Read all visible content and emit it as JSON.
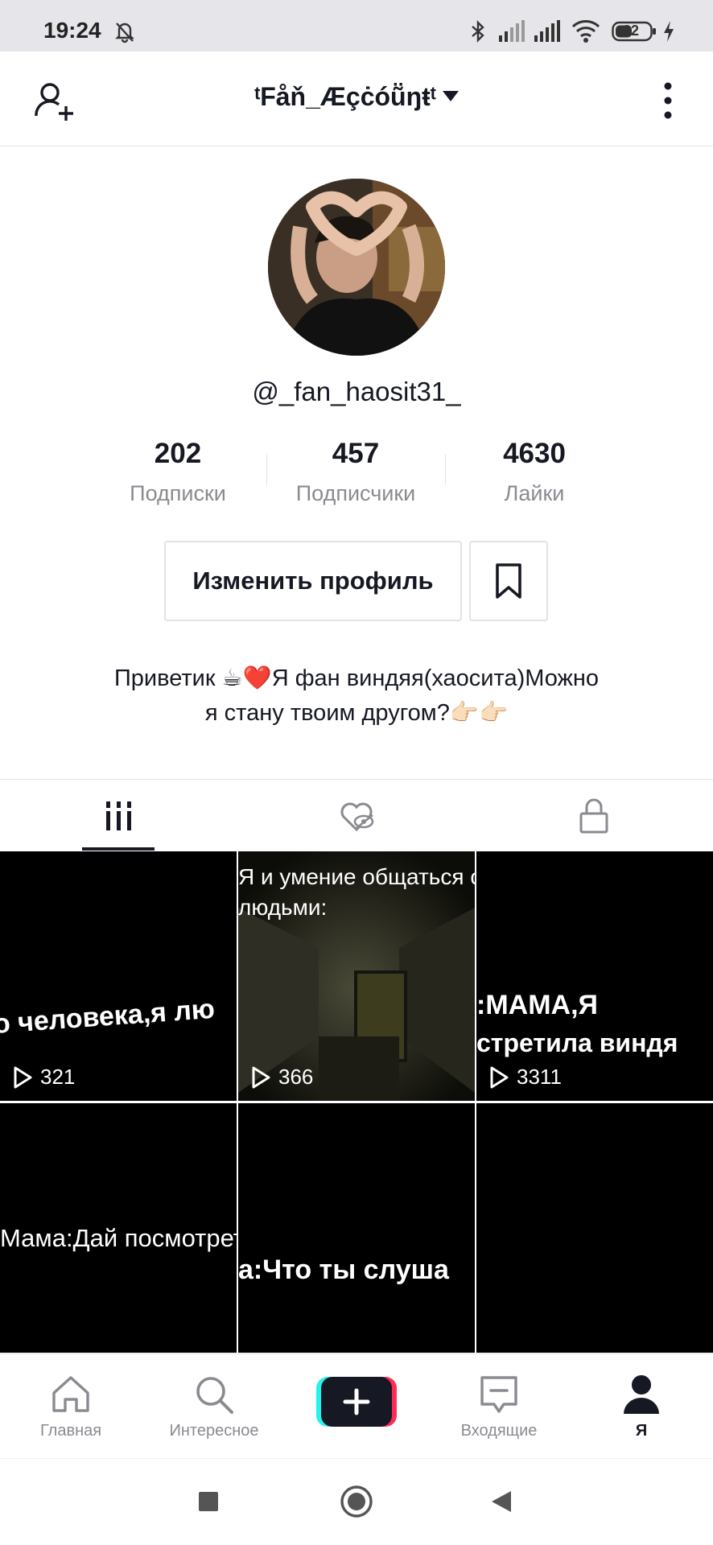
{
  "status_bar": {
    "time": "19:24",
    "battery": "32",
    "icons": [
      "bell-muted-icon",
      "bluetooth-icon",
      "signal-icon",
      "signal-icon",
      "wifi-icon",
      "battery-icon",
      "charging-icon"
    ]
  },
  "header": {
    "title": "ᵗFåň_Æçċóũ̈ŋŧᵗ",
    "icons": [
      "add-user-icon",
      "chevron-down-icon",
      "more-icon"
    ]
  },
  "profile": {
    "username": "@_fan_haosit31_",
    "stats": [
      {
        "value": "202",
        "label": "Подписки"
      },
      {
        "value": "457",
        "label": "Подписчики"
      },
      {
        "value": "4630",
        "label": "Лайки"
      }
    ],
    "edit_label": "Изменить профиль",
    "bio_line1": "Приветик ☕❤️Я фан виндяя(хаосита)Можно",
    "bio_line2": "я стану твоим другом?👉🏻👉🏻"
  },
  "tabs": {
    "icons": [
      "grid-icon",
      "liked-hidden-icon",
      "lock-icon"
    ],
    "selected": 0
  },
  "videos": [
    {
      "caption": "о человека,я лю",
      "views": "321"
    },
    {
      "caption_line1": "Я и умение общаться с",
      "caption_line2": "людьми:",
      "views": "366"
    },
    {
      "caption_line1": ":МАМА,Я",
      "caption_line2": "стретила виндя",
      "views": "3311"
    },
    {
      "caption": "Мама:Дай посмотреть"
    },
    {
      "caption": "а:Что ты слуша"
    },
    {
      "caption": ""
    }
  ],
  "bottom_nav": [
    {
      "label": "Главная",
      "icon": "home-icon"
    },
    {
      "label": "Интересное",
      "icon": "search-icon"
    },
    {
      "label": "",
      "icon": "plus-icon"
    },
    {
      "label": "Входящие",
      "icon": "inbox-icon"
    },
    {
      "label": "Я",
      "icon": "profile-icon"
    }
  ],
  "system_nav": [
    "recents-icon",
    "home-circle-icon",
    "back-icon"
  ]
}
